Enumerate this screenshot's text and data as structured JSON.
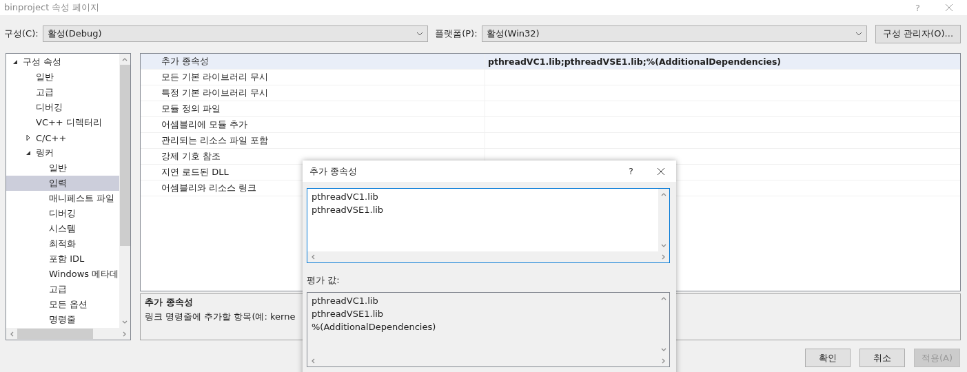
{
  "window": {
    "title": "binproject 속성 페이지",
    "help": "?"
  },
  "config": {
    "label": "구성(C):",
    "value": "활성(Debug)"
  },
  "platform": {
    "label": "플랫폼(P):",
    "value": "활성(Win32)"
  },
  "config_manager": "구성 관리자(O)...",
  "tree": [
    {
      "label": "구성 속성",
      "expanded": true,
      "selected": false,
      "children": [
        {
          "label": "일반",
          "selected": false
        },
        {
          "label": "고급",
          "selected": false
        },
        {
          "label": "디버깅",
          "selected": false
        },
        {
          "label": "VC++ 디렉터리",
          "selected": false
        },
        {
          "label": "C/C++",
          "expanded": false,
          "selected": false
        },
        {
          "label": "링커",
          "expanded": true,
          "selected": false,
          "children": [
            {
              "label": "일반",
              "selected": false
            },
            {
              "label": "입력",
              "selected": true
            },
            {
              "label": "매니페스트 파일",
              "selected": false
            },
            {
              "label": "디버깅",
              "selected": false
            },
            {
              "label": "시스템",
              "selected": false
            },
            {
              "label": "최적화",
              "selected": false
            },
            {
              "label": "포함 IDL",
              "selected": false
            },
            {
              "label": "Windows 메타데",
              "selected": false
            },
            {
              "label": "고급",
              "selected": false
            },
            {
              "label": "모든 옵션",
              "selected": false
            },
            {
              "label": "명령줄",
              "selected": false
            }
          ]
        }
      ]
    }
  ],
  "properties": [
    {
      "name": "추가 종속성",
      "value": "pthreadVC1.lib;pthreadVSE1.lib;%(AdditionalDependencies)",
      "selected": true
    },
    {
      "name": "모든 기본 라이브러리 무시",
      "selected": false
    },
    {
      "name": "특정 기본 라이브러리 무시",
      "selected": false
    },
    {
      "name": "모듈 정의 파일",
      "selected": false
    },
    {
      "name": "어셈블리에 모듈 추가",
      "selected": false
    },
    {
      "name": "관리되는 리소스 파일 포함",
      "selected": false
    },
    {
      "name": "강제 기호 참조",
      "selected": false
    },
    {
      "name": "지연 로드된 DLL",
      "selected": false
    },
    {
      "name": "어셈블리와 리소스 링크",
      "selected": false
    }
  ],
  "description": {
    "title": "추가 종속성",
    "text": "링크 명령줄에 추가할 항목(예: kerne"
  },
  "buttons": [
    {
      "label": "확인",
      "disabled": false
    },
    {
      "label": "취소",
      "disabled": false
    },
    {
      "label": "적용(A)",
      "disabled": true
    }
  ],
  "dialog": {
    "title": "추가 종속성",
    "help": "?",
    "value_lines": [
      "pthreadVC1.lib",
      "pthreadVSE1.lib"
    ],
    "evaluated_label": "평가 값:",
    "evaluated_lines": [
      "pthreadVC1.lib",
      "pthreadVSE1.lib",
      "%(AdditionalDependencies)"
    ]
  }
}
